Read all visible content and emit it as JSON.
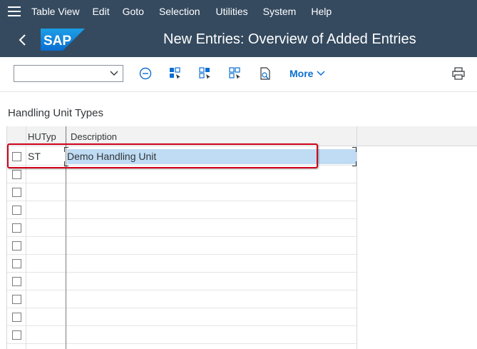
{
  "menu": {
    "items": [
      "Table View",
      "Edit",
      "Goto",
      "Selection",
      "Utilities",
      "System",
      "Help"
    ]
  },
  "shell": {
    "logo_text": "SAP",
    "title": "New Entries: Overview of Added Entries"
  },
  "toolbar": {
    "command_field_value": "",
    "icons": [
      "minus-circle-icon",
      "select-all-icon",
      "deselect-icon",
      "select-block-icon",
      "print-preview-icon"
    ],
    "more_label": "More",
    "print_icon": "printer-icon"
  },
  "section": {
    "title": "Handling Unit Types"
  },
  "table": {
    "columns": [
      "HUTyp",
      "Description"
    ],
    "rows": [
      {
        "hutyp": "ST",
        "description": "Demo Handling Unit"
      },
      {
        "hutyp": "",
        "description": ""
      },
      {
        "hutyp": "",
        "description": ""
      },
      {
        "hutyp": "",
        "description": ""
      },
      {
        "hutyp": "",
        "description": ""
      },
      {
        "hutyp": "",
        "description": ""
      },
      {
        "hutyp": "",
        "description": ""
      },
      {
        "hutyp": "",
        "description": ""
      },
      {
        "hutyp": "",
        "description": ""
      },
      {
        "hutyp": "",
        "description": ""
      },
      {
        "hutyp": "",
        "description": ""
      }
    ]
  },
  "colors": {
    "shell_bg": "#354a5f",
    "accent": "#0a6ed1",
    "highlight": "#d0021b",
    "selection": "#bfdcf4"
  }
}
